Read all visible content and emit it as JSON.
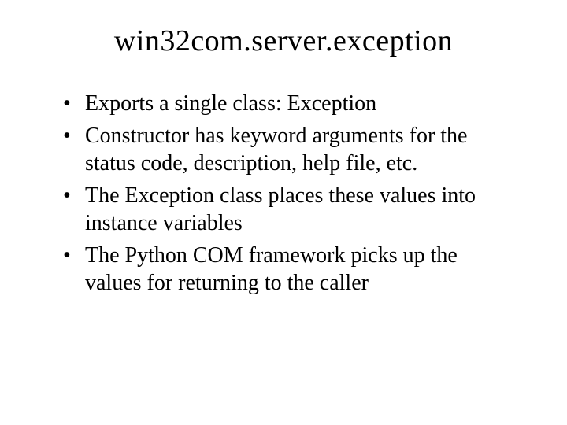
{
  "slide": {
    "title": "win32com.server.exception",
    "bullets": [
      "Exports a single class: Exception",
      "Constructor has keyword arguments for the status code, description, help file, etc.",
      "The Exception class places these values into instance variables",
      "The Python COM framework picks up the values for returning to the caller"
    ]
  }
}
